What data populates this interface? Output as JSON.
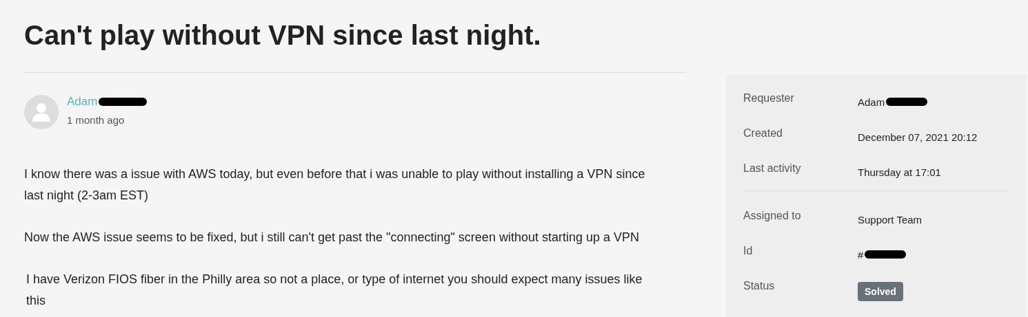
{
  "title": "Can't play without VPN since last night.",
  "post": {
    "author": {
      "name": "Adam",
      "redacted": true
    },
    "time": "1 month ago",
    "paragraphs": [
      "I know there was a issue with AWS today, but even before that i was unable to play without installing a VPN since last night (2-3am EST)",
      "Now the AWS issue seems to be fixed, but i still can't get past the \"connecting\" screen without starting up a VPN",
      "I have Verizon FIOS fiber in the Philly area so not a place, or type of internet you should expect many issues like this"
    ]
  },
  "details": {
    "groups": [
      [
        {
          "label": "Requester",
          "value": "Adam",
          "kind": "text",
          "redacted": true
        },
        {
          "label": "Created",
          "value": "December 07, 2021 20:12",
          "kind": "text",
          "redacted": false
        },
        {
          "label": "Last activity",
          "value": "Thursday at 17:01",
          "kind": "text",
          "redacted": false
        }
      ],
      [
        {
          "label": "Assigned to",
          "value": "Support Team",
          "kind": "text",
          "redacted": false
        },
        {
          "label": "Id",
          "value": "#",
          "kind": "text",
          "redacted": true
        },
        {
          "label": "Status",
          "value": "Solved",
          "kind": "badge",
          "redacted": false
        }
      ]
    ]
  }
}
